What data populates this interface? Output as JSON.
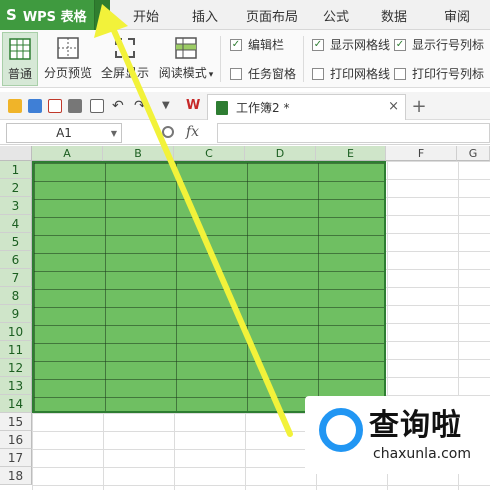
{
  "app": {
    "logo_text": "WPS 表格",
    "logo_glyph": "S",
    "dropdown_glyph": "▾"
  },
  "menu_tabs": [
    "开始",
    "插入",
    "页面布局",
    "公式",
    "数据",
    "审阅"
  ],
  "ribbon": {
    "buttons": [
      "普通",
      "分页预览",
      "全屏显示",
      "阅读模式"
    ],
    "reading_mode_arrow": "▾",
    "checkboxes": [
      {
        "label": "编辑栏",
        "checked": true
      },
      {
        "label": "任务窗格",
        "checked": false
      },
      {
        "label": "显示网格线",
        "checked": true
      },
      {
        "label": "打印网格线",
        "checked": false
      },
      {
        "label": "显示行号列标",
        "checked": true
      },
      {
        "label": "打印行号列标",
        "checked": false
      }
    ]
  },
  "document_tab": {
    "title": "工作簿2 *",
    "close": "×",
    "new_tab": "+"
  },
  "formula_bar": {
    "name_box": "A1",
    "fx": "fx",
    "value": ""
  },
  "sheet": {
    "columns": [
      "A",
      "B",
      "C",
      "D",
      "E",
      "F",
      "G"
    ],
    "rows": [
      "1",
      "2",
      "3",
      "4",
      "5",
      "6",
      "7",
      "8",
      "9",
      "10",
      "11",
      "12",
      "13",
      "14",
      "15",
      "16",
      "17",
      "18"
    ],
    "selection": "A1:E14",
    "selection_color": "#6fbf62"
  },
  "watermark": {
    "chinese": "查询啦",
    "domain": "chaxunla.com"
  },
  "colors": {
    "brand_green": "#3f9a3f",
    "arrow_yellow": "#f2f23a",
    "watermark_blue": "#2196f3"
  }
}
